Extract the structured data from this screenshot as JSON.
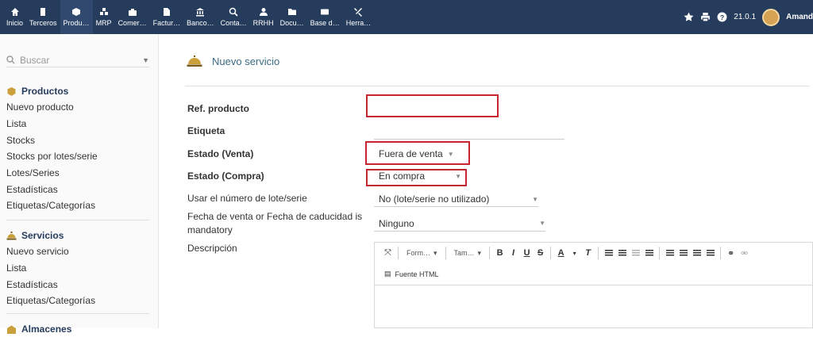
{
  "topbar": {
    "menu": [
      {
        "label": "Inicio",
        "icon": "home-icon"
      },
      {
        "label": "Terceros",
        "icon": "building-icon"
      },
      {
        "label": "Produ…",
        "icon": "cube-icon",
        "active": true
      },
      {
        "label": "MRP",
        "icon": "cubes-icon"
      },
      {
        "label": "Comer…",
        "icon": "briefcase-icon"
      },
      {
        "label": "Factur…",
        "icon": "file-icon"
      },
      {
        "label": "Banco…",
        "icon": "bank-icon"
      },
      {
        "label": "Conta…",
        "icon": "search-dollar-icon"
      },
      {
        "label": "RRHH",
        "icon": "user-tie-icon"
      },
      {
        "label": "Docu…",
        "icon": "folder-icon"
      },
      {
        "label": "Base d…",
        "icon": "card-icon"
      },
      {
        "label": "Herra…",
        "icon": "tools-icon"
      }
    ],
    "version": "21.0.1",
    "user_name": "Amand"
  },
  "sidebar": {
    "search_placeholder": "Buscar",
    "sections": [
      {
        "title": "Productos",
        "icon": "cube-icon",
        "items": [
          "Nuevo producto",
          "Lista",
          "Stocks",
          "Stocks por lotes/serie",
          "Lotes/Series",
          "Estadísticas",
          "Etiquetas/Categorías"
        ]
      },
      {
        "title": "Servicios",
        "icon": "concierge-bell-icon",
        "items": [
          "Nuevo servicio",
          "Lista",
          "Estadísticas",
          "Etiquetas/Categorías"
        ]
      },
      {
        "title": "Almacenes",
        "icon": "warehouse-icon",
        "items": []
      }
    ]
  },
  "main": {
    "page_title": "Nuevo servicio",
    "fields": {
      "ref_label": "Ref. producto",
      "ref_value": "",
      "etiqueta_label": "Etiqueta",
      "etiqueta_value": "",
      "estado_venta_label": "Estado (Venta)",
      "estado_venta_value": "Fuera de venta",
      "estado_compra_label": "Estado (Compra)",
      "estado_compra_value": "En compra",
      "lote_label": "Usar el número de lote/serie",
      "lote_value": "No (lote/serie no utilizado)",
      "fecha_label": "Fecha de venta or Fecha de caducidad is mandatory",
      "fecha_value": "Ninguno",
      "descripcion_label": "Descripción"
    },
    "editor": {
      "format_combo": "Form…",
      "size_combo": "Tam…",
      "source_label": "Fuente HTML",
      "content": ""
    }
  },
  "colors": {
    "topbar_bg": "#263c5c",
    "highlight_box": "#c8242f",
    "title_text": "#3c6b84"
  }
}
